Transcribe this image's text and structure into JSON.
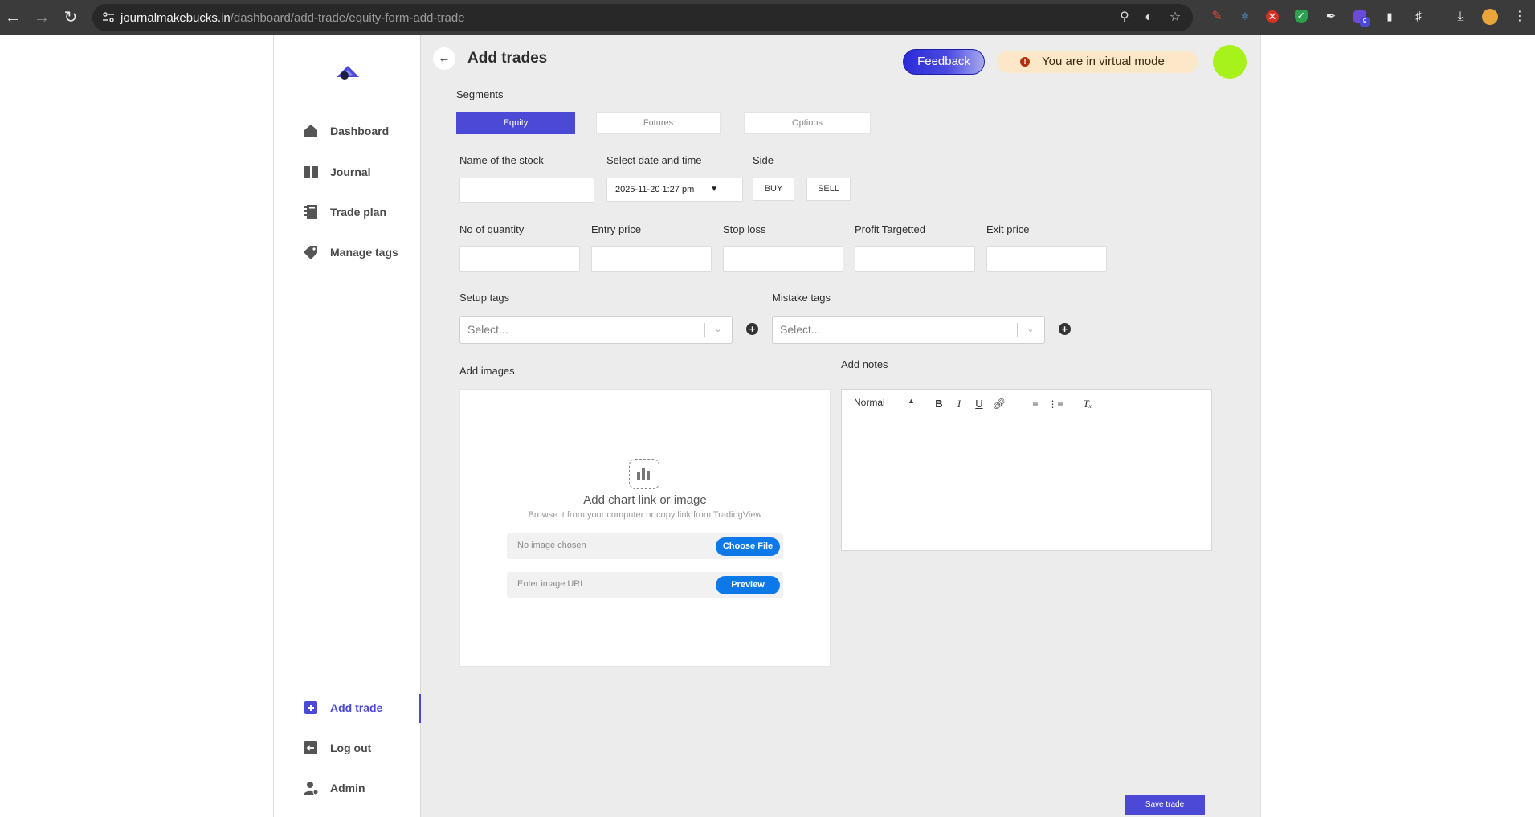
{
  "browser": {
    "url_host": "journalmakebucks.in",
    "url_path": "/dashboard/add-trade/equity-form-add-trade",
    "extension_badge": "9"
  },
  "sidebar": {
    "items": [
      {
        "label": "Dashboard",
        "icon": "home-icon"
      },
      {
        "label": "Journal",
        "icon": "book-icon"
      },
      {
        "label": "Trade plan",
        "icon": "notebook-icon"
      },
      {
        "label": "Manage tags",
        "icon": "tag-icon"
      }
    ],
    "bottom_items": [
      {
        "label": "Add trade",
        "icon": "plus-square-icon",
        "active": true
      },
      {
        "label": "Log out",
        "icon": "logout-icon"
      },
      {
        "label": "Admin",
        "icon": "user-icon"
      }
    ]
  },
  "header": {
    "title": "Add trades",
    "feedback_label": "Feedback",
    "virtual_mode_text": "You are in virtual mode"
  },
  "segments": {
    "label": "Segments",
    "options": [
      "Equity",
      "Futures",
      "Options"
    ],
    "selected": "Equity"
  },
  "form": {
    "stock_name_label": "Name of the stock",
    "datetime_label": "Select date and time",
    "datetime_value": "2025-11-20  1:27   pm",
    "side_label": "Side",
    "buy_label": "BUY",
    "sell_label": "SELL",
    "quantity_label": "No of quantity",
    "entry_price_label": "Entry price",
    "stop_loss_label": "Stop loss",
    "profit_target_label": "Profit Targetted",
    "exit_price_label": "Exit price",
    "setup_tags_label": "Setup tags",
    "mistake_tags_label": "Mistake tags",
    "select_placeholder": "Select...",
    "add_images_label": "Add images",
    "add_notes_label": "Add notes"
  },
  "images": {
    "title": "Add chart link or image",
    "subtitle": "Browse it from your computer or copy link from TradingView",
    "file_placeholder": "No image chosen",
    "choose_file_label": "Choose File",
    "url_placeholder": "Enter image URL",
    "preview_label": "Preview"
  },
  "editor": {
    "format_label": "Normal"
  },
  "save_label": "Save trade",
  "colors": {
    "accent": "#4b49d6",
    "primary_blue": "#0d79e8",
    "warning_bg": "#fde7c9",
    "avatar": "#a7f21b"
  }
}
